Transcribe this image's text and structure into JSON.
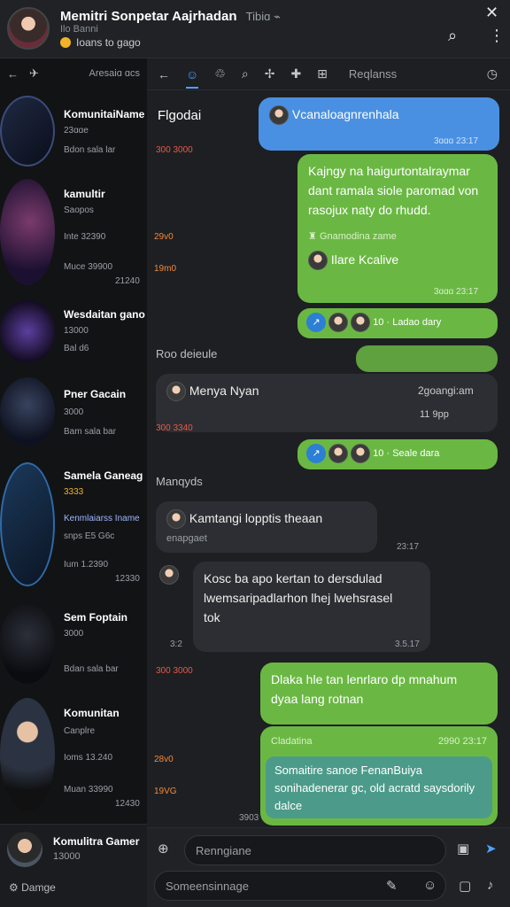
{
  "header": {
    "title": "Memitri Sonpetar Aajrhadan",
    "title_suffix": "Tibiɑ ⌁",
    "subtitle": "Ilo Banni",
    "status": "Ioans to gago"
  },
  "sidebar": {
    "top_label": "Aresaiɑ ɑcs",
    "items": [
      {
        "title": "KomunitaiName",
        "sub": "23ɑɑe",
        "meta": "Bdon sala lar",
        "time": ""
      },
      {
        "title": "kamultir",
        "sub": "Saopos",
        "meta": "Inte 32390",
        "meta2": "",
        "extra": "Muce 39900",
        "extra2": "21240"
      },
      {
        "title": "Wesdaitan gano",
        "sub": "13000",
        "meta": "Bal d6",
        "time": ""
      },
      {
        "title": "Pner Gacain",
        "sub": "3000",
        "meta": "Bam sala bar",
        "time": ""
      },
      {
        "title": "Samela Ganeag",
        "sub": "3333",
        "meta": "Kenmlaiarss Iname",
        "time": "snps E5 G6c",
        "extra": "Ium 1.2390",
        "extra2": "12330"
      },
      {
        "title": "Sem Foptain",
        "sub": "3000",
        "meta": "Bdan sala bar",
        "time": ""
      },
      {
        "title": "Komunitan",
        "sub": "Canplre",
        "meta": "Ioms 13.240",
        "time": "",
        "extra": "Muan 33990",
        "extra2": "12430"
      }
    ],
    "bottom": {
      "name": "Komulitra Gamer",
      "count": "13000",
      "label": "Damge"
    }
  },
  "chat": {
    "tabs": [
      "←",
      "☺",
      "♲",
      "⌕",
      "✢",
      "✚",
      "⊞"
    ],
    "tab_label": "Reqlanss",
    "messages": {
      "m1": {
        "text": "Vcanaloagnrenhala",
        "time": "3ɑɑɑ 23:17"
      },
      "left1": "Flgodai",
      "red1": "300 3000",
      "m2": {
        "text": "Kajngy na haigurtontalraymar dant ramala siole paromad von rasojux naty do rhudd.",
        "sub1": "Gnamodina zame",
        "sub2": "Ilare Kcalive",
        "time": "3ɑɑɑ 23:17"
      },
      "reacts1": "10 · Ladao dary",
      "label1": "Roo deieule",
      "m3": {
        "name": "Menya Nyan",
        "r": "2goangi:am",
        "r2": "11 9pp",
        "red": "300 3340"
      },
      "reacts2": "10 · Seale dara",
      "label2": "Manqyds",
      "m4": {
        "text": "Kamtangi lopptis theaan",
        "sub": "enapgaet",
        "time": "23:17"
      },
      "m5": {
        "text": "Kosc ba apo kertan to dersdulad",
        "text2": "lwemsaripadlarhon lhej lwehsrasel",
        "text3": "tok",
        "time": "3.5.17",
        "left": "3:2"
      },
      "red2": "300 3000",
      "m6": {
        "text": "Dlaka hle tan lenrlaro dp mnahum dyaa lang rotnan"
      },
      "m7": {
        "head": "Cladatina",
        "time": "2990 23:17",
        "text": "Somaitire sanoe FenanBuiya sonihadenerar gc, old acratd saysdorily dalce",
        "corner": "3903"
      },
      "times": [
        "29v0",
        "19m0",
        "28v0",
        "19VG"
      ]
    },
    "compose": {
      "placeholder": "Renngiane",
      "placeholder2": "Someensinnage"
    }
  }
}
